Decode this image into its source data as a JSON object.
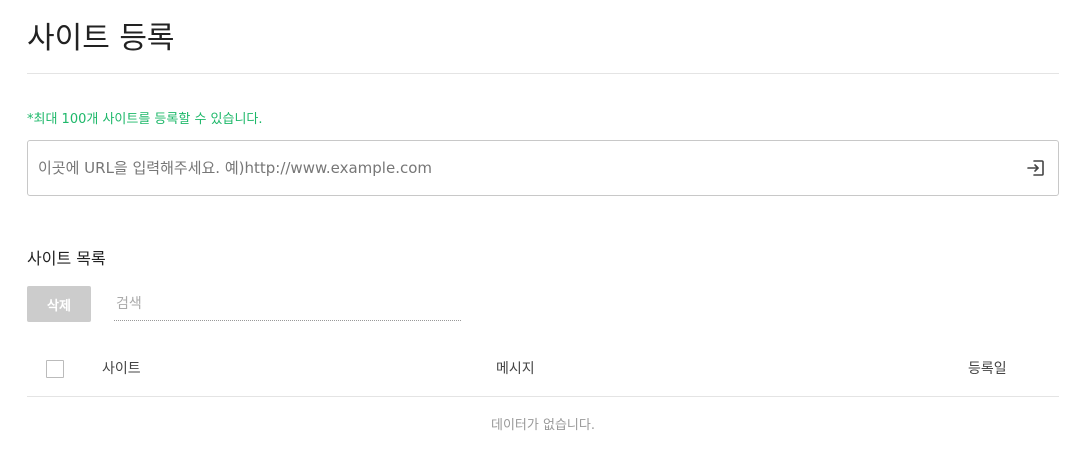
{
  "header": {
    "title": "사이트 등록"
  },
  "registration": {
    "limit_notice": "*최대 100개 사이트를 등록할 수 있습니다.",
    "url_placeholder": "이곳에 URL을 입력해주세요. 예)http://www.example.com",
    "url_value": "",
    "submit_icon": "enter-icon"
  },
  "site_list": {
    "title": "사이트 목록",
    "delete_label": "삭제",
    "search_placeholder": "검색",
    "search_value": "",
    "columns": {
      "site": "사이트",
      "message": "메시지",
      "registered_date": "등록일"
    },
    "rows": [],
    "empty_message": "데이터가 없습니다."
  },
  "colors": {
    "notice_green": "#1eb86a",
    "disabled_button": "#cccccc",
    "divider": "#e4e4e4"
  }
}
